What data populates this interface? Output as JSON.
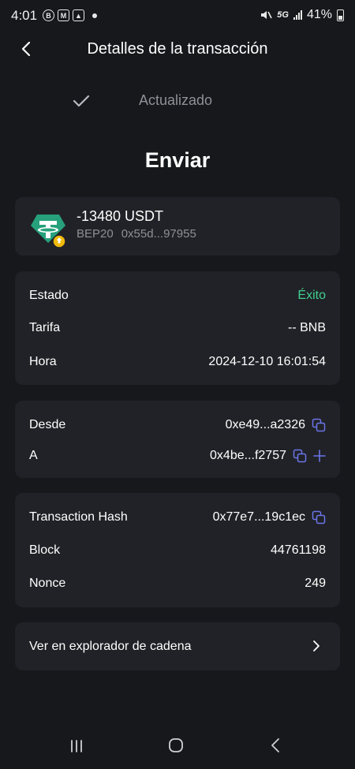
{
  "status_bar": {
    "time": "4:01",
    "network": "5G",
    "battery": "41%"
  },
  "header": {
    "title": "Detalles de la transacción"
  },
  "update_status": "Actualizado",
  "page_title": "Enviar",
  "token": {
    "amount": "-13480 USDT",
    "network": "BEP20",
    "address": "0x55d...97955"
  },
  "status_card": {
    "status_label": "Estado",
    "status_value": "Éxito",
    "fee_label": "Tarifa",
    "fee_value": "-- BNB",
    "time_label": "Hora",
    "time_value": "2024-12-10 16:01:54"
  },
  "address_card": {
    "from_label": "Desde",
    "from_value": "0xe49...a2326",
    "to_label": "A",
    "to_value": "0x4be...f2757"
  },
  "hash_card": {
    "hash_label": "Transaction Hash",
    "hash_value": "0x77e7...19c1ec",
    "block_label": "Block",
    "block_value": "44761198",
    "nonce_label": "Nonce",
    "nonce_value": "249"
  },
  "explorer": {
    "label": "Ver en explorador de cadena"
  },
  "colors": {
    "background": "#17181c",
    "card": "#212227",
    "success": "#3fd18f",
    "accent": "#6b74e8",
    "muted": "#8e9099"
  }
}
